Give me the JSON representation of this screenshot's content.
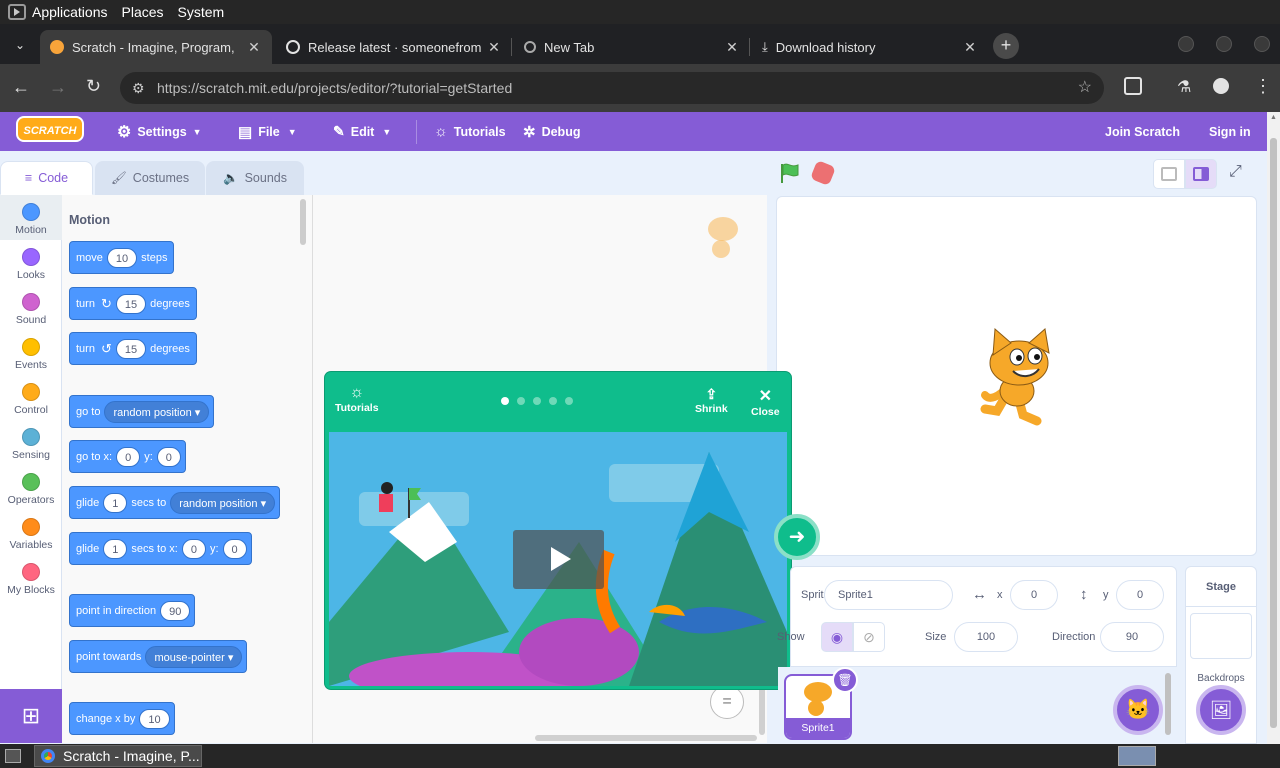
{
  "sysbar": {
    "items": [
      "Applications",
      "Places",
      "System"
    ]
  },
  "tabs": [
    {
      "title": "Scratch - Imagine, Program,",
      "close": "✕"
    },
    {
      "title": "Release latest · someonefrom",
      "close": "✕"
    },
    {
      "title": "New Tab",
      "close": "✕"
    },
    {
      "title": "Download history",
      "close": "✕"
    }
  ],
  "address": {
    "url": "https://scratch.mit.edu/projects/editor/?tutorial=getStarted",
    "host": "https://scratch.mit.edu",
    "path": "/projects/editor/?tutorial=getStarted"
  },
  "menu": {
    "logo": "SCRATCH",
    "settings": "Settings",
    "file": "File",
    "edit": "Edit",
    "tutorials": "Tutorials",
    "debug": "Debug",
    "join": "Join Scratch",
    "signin": "Sign in"
  },
  "editor_tabs": {
    "code": "Code",
    "costumes": "Costumes",
    "sounds": "Sounds"
  },
  "categories": [
    {
      "label": "Motion",
      "color": "#4c97ff"
    },
    {
      "label": "Looks",
      "color": "#9966ff"
    },
    {
      "label": "Sound",
      "color": "#cf63cf"
    },
    {
      "label": "Events",
      "color": "#ffbf00"
    },
    {
      "label": "Control",
      "color": "#ffab19"
    },
    {
      "label": "Sensing",
      "color": "#5cb1d6"
    },
    {
      "label": "Operators",
      "color": "#59c059"
    },
    {
      "label": "Variables",
      "color": "#ff8c1a"
    },
    {
      "label": "My Blocks",
      "color": "#ff6680"
    }
  ],
  "palette": {
    "heading": "Motion",
    "b1": {
      "a": "move",
      "v": "10",
      "b": "steps"
    },
    "b2": {
      "a": "turn",
      "v": "15",
      "b": "degrees"
    },
    "b3": {
      "a": "turn",
      "v": "15",
      "b": "degrees"
    },
    "b4": {
      "a": "go to",
      "dd": "random position"
    },
    "b5": {
      "a": "go to x:",
      "x": "0",
      "y_label": "y:",
      "y": "0"
    },
    "b6": {
      "a": "glide",
      "v": "1",
      "b": "secs to",
      "dd": "random position"
    },
    "b7": {
      "a": "glide",
      "v": "1",
      "b": "secs to x:",
      "x": "0",
      "y_label": "y:",
      "y": "0"
    },
    "b8": {
      "a": "point in direction",
      "v": "90"
    },
    "b9": {
      "a": "point towards",
      "dd": "mouse-pointer"
    },
    "b10": {
      "a": "change x by",
      "v": "10"
    }
  },
  "tutorial": {
    "label": "Tutorials",
    "shrink": "Shrink",
    "close": "Close",
    "steps": 5,
    "current_step": 1
  },
  "sprite": {
    "label": "Sprite",
    "name": "Sprite1",
    "x_label": "x",
    "x": "0",
    "y_label": "y",
    "y": "0",
    "show_label": "Show",
    "size_label": "Size",
    "size": "100",
    "direction_label": "Direction",
    "direction": "90"
  },
  "sprites": [
    {
      "name": "Sprite1"
    }
  ],
  "stage_panel": {
    "title": "Stage",
    "backdrops": "Backdrops"
  },
  "taskbar": {
    "window": "Scratch - Imagine, P..."
  },
  "colors": {
    "scratch_purple": "#855cd6",
    "motion_blue": "#4c97ff",
    "tutorial_green": "#0fbd8c"
  }
}
